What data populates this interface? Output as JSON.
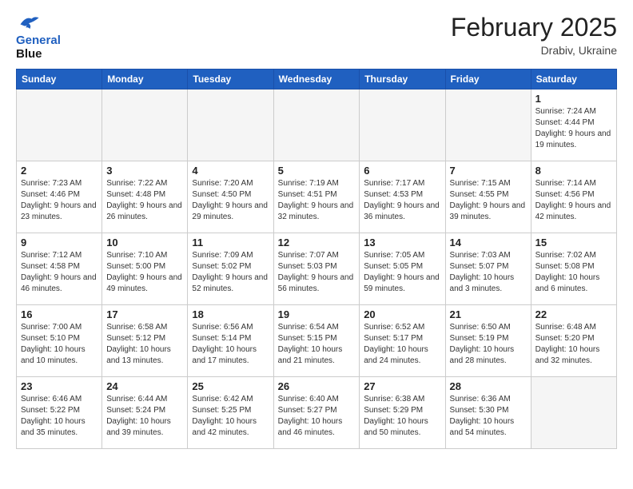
{
  "header": {
    "logo_line1": "General",
    "logo_line2": "Blue",
    "month_title": "February 2025",
    "subtitle": "Drabiv, Ukraine"
  },
  "weekdays": [
    "Sunday",
    "Monday",
    "Tuesday",
    "Wednesday",
    "Thursday",
    "Friday",
    "Saturday"
  ],
  "weeks": [
    [
      {
        "day": "",
        "info": ""
      },
      {
        "day": "",
        "info": ""
      },
      {
        "day": "",
        "info": ""
      },
      {
        "day": "",
        "info": ""
      },
      {
        "day": "",
        "info": ""
      },
      {
        "day": "",
        "info": ""
      },
      {
        "day": "1",
        "info": "Sunrise: 7:24 AM\nSunset: 4:44 PM\nDaylight: 9 hours and 19 minutes."
      }
    ],
    [
      {
        "day": "2",
        "info": "Sunrise: 7:23 AM\nSunset: 4:46 PM\nDaylight: 9 hours and 23 minutes."
      },
      {
        "day": "3",
        "info": "Sunrise: 7:22 AM\nSunset: 4:48 PM\nDaylight: 9 hours and 26 minutes."
      },
      {
        "day": "4",
        "info": "Sunrise: 7:20 AM\nSunset: 4:50 PM\nDaylight: 9 hours and 29 minutes."
      },
      {
        "day": "5",
        "info": "Sunrise: 7:19 AM\nSunset: 4:51 PM\nDaylight: 9 hours and 32 minutes."
      },
      {
        "day": "6",
        "info": "Sunrise: 7:17 AM\nSunset: 4:53 PM\nDaylight: 9 hours and 36 minutes."
      },
      {
        "day": "7",
        "info": "Sunrise: 7:15 AM\nSunset: 4:55 PM\nDaylight: 9 hours and 39 minutes."
      },
      {
        "day": "8",
        "info": "Sunrise: 7:14 AM\nSunset: 4:56 PM\nDaylight: 9 hours and 42 minutes."
      }
    ],
    [
      {
        "day": "9",
        "info": "Sunrise: 7:12 AM\nSunset: 4:58 PM\nDaylight: 9 hours and 46 minutes."
      },
      {
        "day": "10",
        "info": "Sunrise: 7:10 AM\nSunset: 5:00 PM\nDaylight: 9 hours and 49 minutes."
      },
      {
        "day": "11",
        "info": "Sunrise: 7:09 AM\nSunset: 5:02 PM\nDaylight: 9 hours and 52 minutes."
      },
      {
        "day": "12",
        "info": "Sunrise: 7:07 AM\nSunset: 5:03 PM\nDaylight: 9 hours and 56 minutes."
      },
      {
        "day": "13",
        "info": "Sunrise: 7:05 AM\nSunset: 5:05 PM\nDaylight: 9 hours and 59 minutes."
      },
      {
        "day": "14",
        "info": "Sunrise: 7:03 AM\nSunset: 5:07 PM\nDaylight: 10 hours and 3 minutes."
      },
      {
        "day": "15",
        "info": "Sunrise: 7:02 AM\nSunset: 5:08 PM\nDaylight: 10 hours and 6 minutes."
      }
    ],
    [
      {
        "day": "16",
        "info": "Sunrise: 7:00 AM\nSunset: 5:10 PM\nDaylight: 10 hours and 10 minutes."
      },
      {
        "day": "17",
        "info": "Sunrise: 6:58 AM\nSunset: 5:12 PM\nDaylight: 10 hours and 13 minutes."
      },
      {
        "day": "18",
        "info": "Sunrise: 6:56 AM\nSunset: 5:14 PM\nDaylight: 10 hours and 17 minutes."
      },
      {
        "day": "19",
        "info": "Sunrise: 6:54 AM\nSunset: 5:15 PM\nDaylight: 10 hours and 21 minutes."
      },
      {
        "day": "20",
        "info": "Sunrise: 6:52 AM\nSunset: 5:17 PM\nDaylight: 10 hours and 24 minutes."
      },
      {
        "day": "21",
        "info": "Sunrise: 6:50 AM\nSunset: 5:19 PM\nDaylight: 10 hours and 28 minutes."
      },
      {
        "day": "22",
        "info": "Sunrise: 6:48 AM\nSunset: 5:20 PM\nDaylight: 10 hours and 32 minutes."
      }
    ],
    [
      {
        "day": "23",
        "info": "Sunrise: 6:46 AM\nSunset: 5:22 PM\nDaylight: 10 hours and 35 minutes."
      },
      {
        "day": "24",
        "info": "Sunrise: 6:44 AM\nSunset: 5:24 PM\nDaylight: 10 hours and 39 minutes."
      },
      {
        "day": "25",
        "info": "Sunrise: 6:42 AM\nSunset: 5:25 PM\nDaylight: 10 hours and 42 minutes."
      },
      {
        "day": "26",
        "info": "Sunrise: 6:40 AM\nSunset: 5:27 PM\nDaylight: 10 hours and 46 minutes."
      },
      {
        "day": "27",
        "info": "Sunrise: 6:38 AM\nSunset: 5:29 PM\nDaylight: 10 hours and 50 minutes."
      },
      {
        "day": "28",
        "info": "Sunrise: 6:36 AM\nSunset: 5:30 PM\nDaylight: 10 hours and 54 minutes."
      },
      {
        "day": "",
        "info": ""
      }
    ]
  ]
}
